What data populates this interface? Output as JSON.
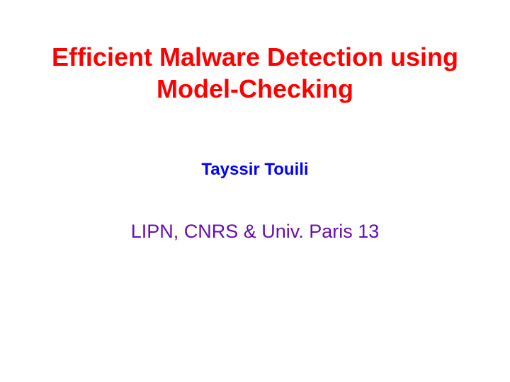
{
  "slide": {
    "title_line1": "Efficient Malware Detection using",
    "title_line2": "Model-Checking",
    "author": "Tayssir Touili",
    "affiliation": "LIPN, CNRS & Univ. Paris 13"
  }
}
